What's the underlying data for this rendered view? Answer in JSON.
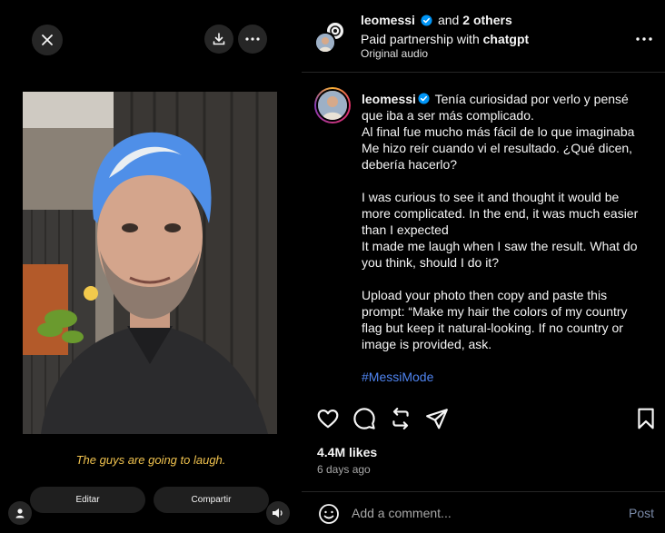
{
  "reel": {
    "caption": "The guys are going to laugh.",
    "edit_label": "Editar",
    "share_label": "Compartir"
  },
  "header": {
    "username": "leomessi",
    "others_prefix": "and",
    "others": "2 others",
    "partnership_prefix": "Paid partnership with",
    "partner": "chatgpt",
    "audio": "Original audio"
  },
  "post": {
    "username": "leomessi",
    "caption_body": " Tenía curiosidad por verlo y pensé que iba a ser más complicado.\nAl final fue mucho más fácil de lo que imaginaba\nMe hizo reír cuando vi el resultado. ¿Qué dicen, debería hacerlo?\n\nI was curious to see it and thought it would be more complicated. In the end, it was much easier than I expected\nIt made me laugh when I saw the result. What do you think, should I do it?\n\nUpload your photo then copy and paste this prompt: “Make my hair the colors of my country flag but keep it natural-looking. If no country or image is provided, ask.\n\n",
    "hashtag": "#MessiMode",
    "likes": "4.4M likes",
    "time": "6 days ago"
  },
  "add_comment": {
    "placeholder": "Add a comment...",
    "post_label": "Post"
  },
  "icons": {
    "close": "close-icon",
    "download": "download-icon",
    "more": "more-icon",
    "profile": "profile-icon",
    "volume": "volume-icon",
    "verified": "verified-badge-icon",
    "heart": "heart-icon",
    "comment": "comment-icon",
    "repost": "repost-icon",
    "share": "share-icon",
    "bookmark": "bookmark-icon",
    "emoji": "emoji-icon"
  },
  "colors": {
    "caption_yellow": "#f0c24e",
    "verified_blue": "#0095f6",
    "hashtag_blue": "#4f84f0",
    "background": "#000000"
  }
}
